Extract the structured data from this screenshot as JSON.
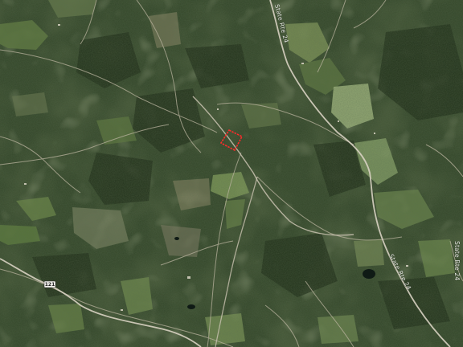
{
  "map": {
    "type": "satellite",
    "colors": {
      "forest_dark": "#23331c",
      "forest": "#34472a",
      "field": "#6f8a4e",
      "field_light": "#9bb07a",
      "clearing": "#8a8565",
      "road": "#c9c2b0",
      "highway": "#d8d2c2",
      "pond": "#101a16",
      "parcel_outline": "#ff2b2b"
    },
    "road_labels": [
      {
        "text": "State Rte 24"
      },
      {
        "text": "State Rte 24"
      },
      {
        "text": "State Rte 24"
      }
    ],
    "route_shield": {
      "text": "121"
    },
    "parcel": {
      "name": "highlighted-parcel"
    }
  }
}
